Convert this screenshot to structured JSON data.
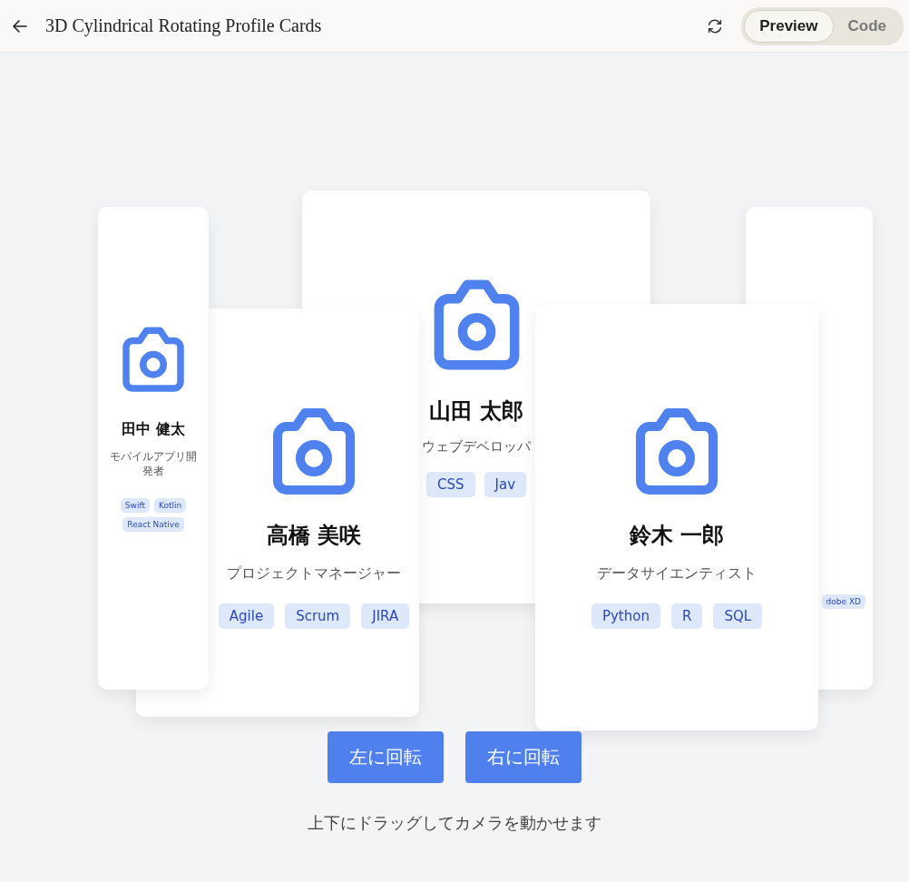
{
  "header": {
    "title": "3D Cylindrical Rotating Profile Cards",
    "view_tabs": [
      {
        "label": "Preview",
        "selected": true
      },
      {
        "label": "Code",
        "selected": false
      }
    ]
  },
  "cards": [
    {
      "kind": "far-left",
      "name": "田中 健太",
      "role": "モバイルアプリ開発者",
      "tags": [
        "Swift",
        "Kotlin",
        "React Native"
      ]
    },
    {
      "kind": "near-left-back",
      "name": "高橋 美咲",
      "role": "プロジェクトマネージャー",
      "tags": [
        "Agile",
        "Scrum",
        "JIRA"
      ]
    },
    {
      "kind": "front",
      "name": "山田 太郎",
      "role": "ウェブデベロッパ",
      "tags": [
        "CSS",
        "Jav"
      ]
    },
    {
      "kind": "near-right-back",
      "name": "鈴木 一郎",
      "role": "データサイエンティスト",
      "tags": [
        "Python",
        "R",
        "SQL"
      ]
    },
    {
      "kind": "far-right",
      "tags": [
        "dobe XD"
      ]
    }
  ],
  "controls": {
    "buttons": [
      "左に回転",
      "右に回転"
    ],
    "hint": "上下にドラッグしてカメラを動かせます"
  }
}
